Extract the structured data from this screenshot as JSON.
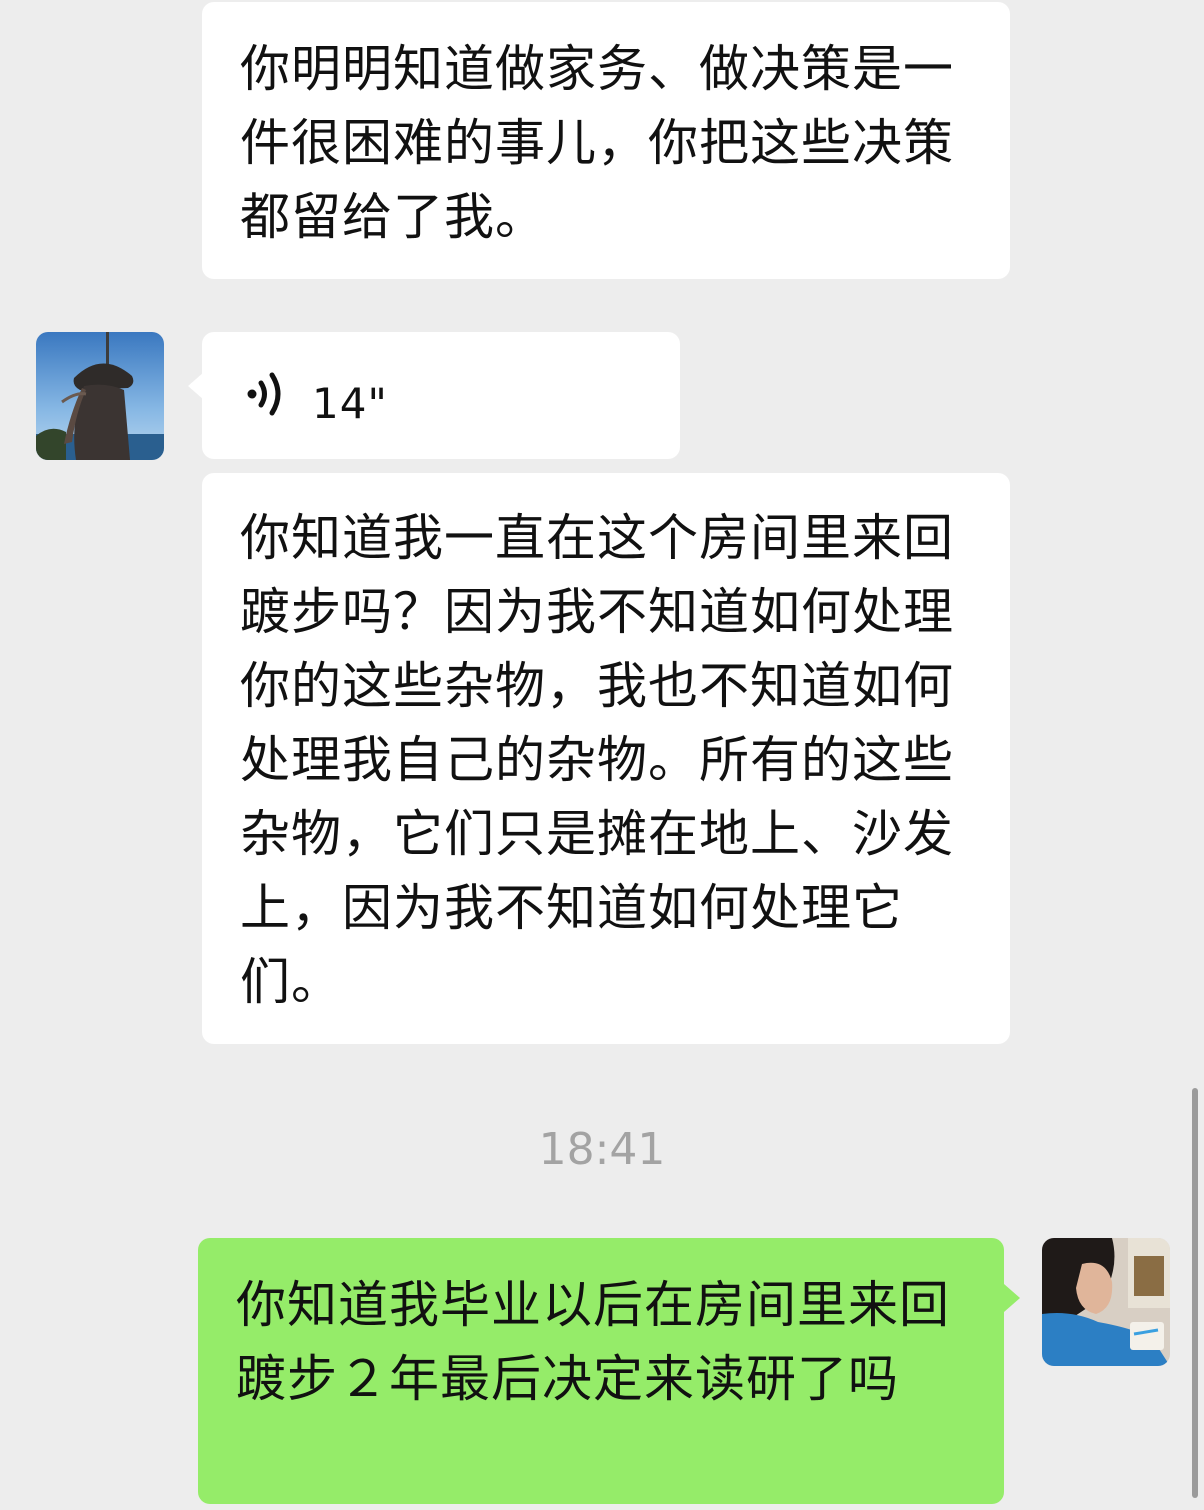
{
  "messages": [
    {
      "direction": "incoming",
      "type": "text",
      "text": "你明明知道做家务、做决策是一件很困难的事儿，你把这些决策都留给了我。"
    },
    {
      "direction": "incoming",
      "type": "voice",
      "duration": "14\""
    },
    {
      "direction": "incoming",
      "type": "text",
      "text": "你知道我一直在这个房间里来回踱步吗？因为我不知道如何处理你的这些杂物，我也不知道如何处理我自己的杂物。所有的这些杂物，它们只是摊在地上、沙发上，因为我不知道如何处理它们。"
    },
    {
      "direction": "outgoing",
      "type": "text",
      "text": "你知道我毕业以后在房间里来回踱步２年最后决定来读研了吗"
    }
  ],
  "timestamp": "18:41",
  "colors": {
    "background": "#ededed",
    "incoming_bubble": "#ffffff",
    "outgoing_bubble": "#95ec69",
    "timestamp_text": "#a3a3a3"
  },
  "icons": {
    "voice": "voice-wave-icon"
  }
}
